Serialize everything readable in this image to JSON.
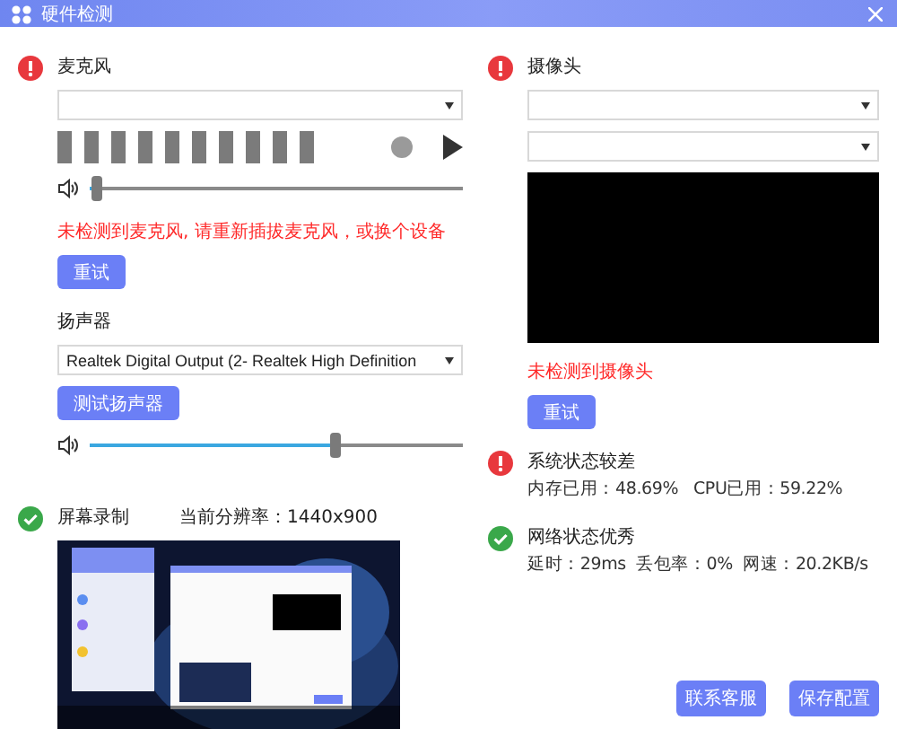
{
  "window": {
    "title": "硬件检测"
  },
  "microphone": {
    "ok": false,
    "title": "麦克风",
    "volume": {
      "level": 0.02
    },
    "error": "未检测到麦克风, 请重新插拔麦克风，或换个设备",
    "retry_button": "重试"
  },
  "speaker": {
    "title": "扬声器",
    "device": "Realtek Digital Output (2- Realtek High Definition",
    "test_button": "测试扬声器",
    "volume": {
      "level": 0.66
    }
  },
  "screen_recording": {
    "ok": true,
    "title": "屏幕录制",
    "resolution": "当前分辨率：1440x900"
  },
  "camera": {
    "ok": false,
    "title": "摄像头",
    "error": "未检测到摄像头",
    "retry_button": "重试"
  },
  "system": {
    "ok": false,
    "title": "系统状态较差",
    "details": "内存已用：48.69%   CPU已用：59.22%"
  },
  "network": {
    "ok": true,
    "title": "网络状态优秀",
    "details": "延时：29ms  丢包率：0%  网速：20.2KB/s"
  },
  "buttons": [
    "联系客服",
    "保存配置"
  ]
}
